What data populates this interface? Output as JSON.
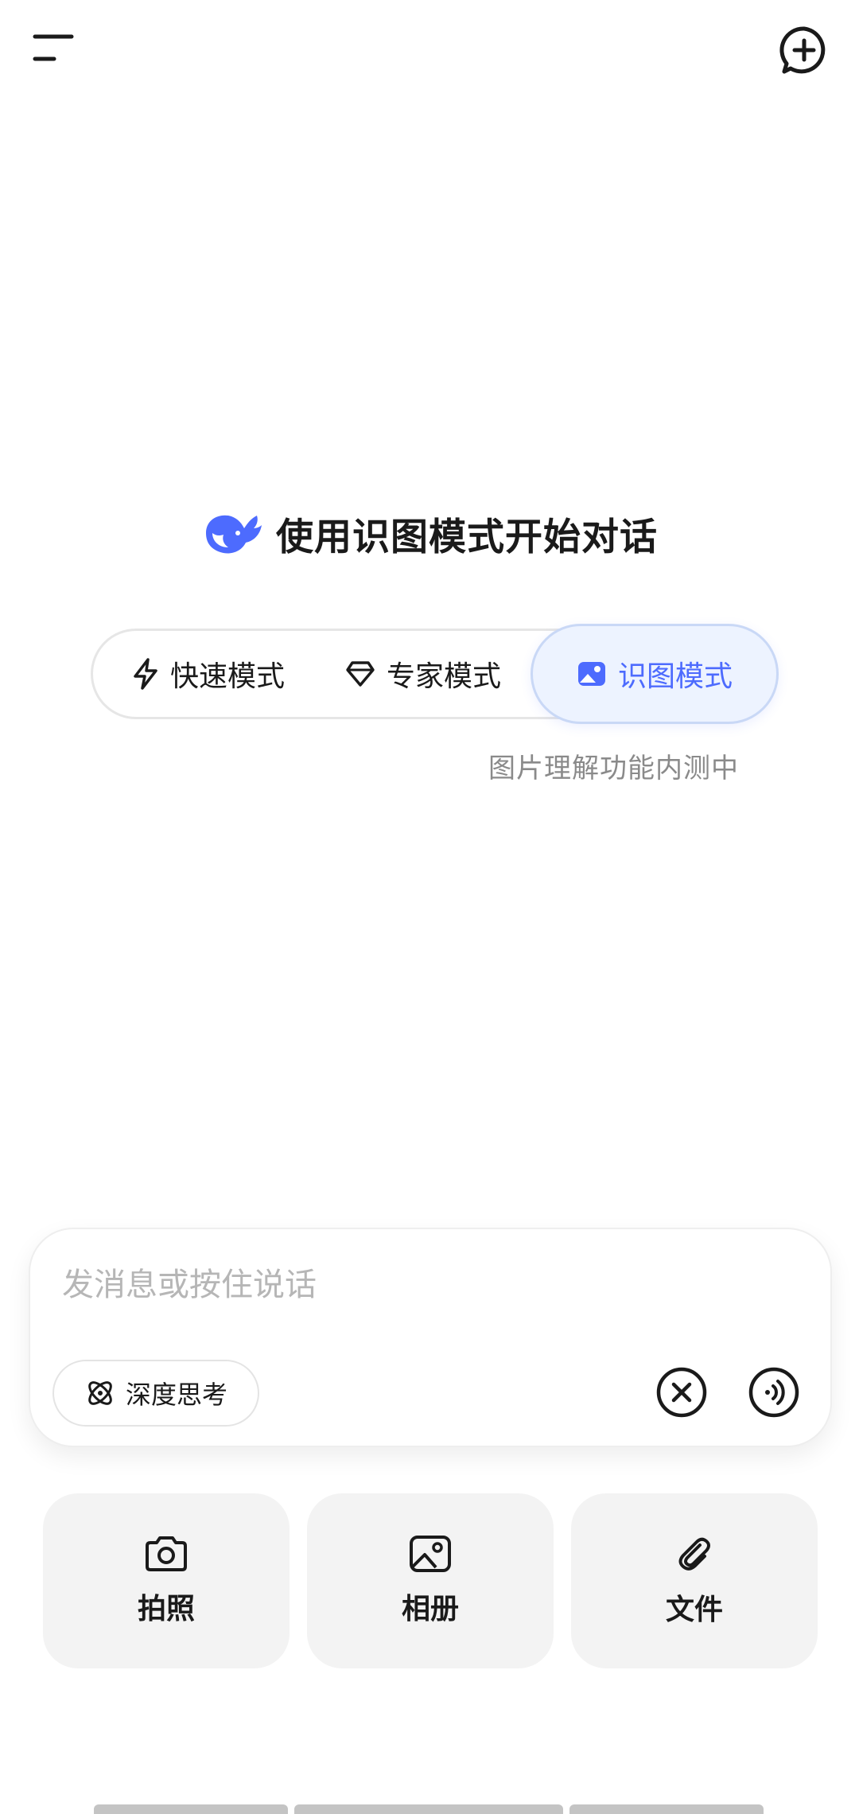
{
  "header": {
    "menu_icon": "menu-icon",
    "new_chat_icon": "new-chat-icon"
  },
  "welcome": {
    "title": "使用识图模式开始对话",
    "logo_icon": "whale-logo-icon"
  },
  "modes": {
    "items": [
      {
        "label": "快速模式",
        "icon": "lightning-icon",
        "selected": false
      },
      {
        "label": "专家模式",
        "icon": "diamond-icon",
        "selected": false
      },
      {
        "label": "识图模式",
        "icon": "image-icon",
        "selected": true
      }
    ],
    "note": "图片理解功能内测中"
  },
  "composer": {
    "placeholder": "发消息或按住说话",
    "value": "",
    "deepthink_label": "深度思考",
    "deepthink_icon": "atom-icon",
    "clear_icon": "close-circle-icon",
    "voice_icon": "voice-wave-icon"
  },
  "actions": [
    {
      "label": "拍照",
      "icon": "camera-icon"
    },
    {
      "label": "相册",
      "icon": "photo-album-icon"
    },
    {
      "label": "文件",
      "icon": "paperclip-icon"
    }
  ],
  "colors": {
    "accent": "#4d6bfe",
    "accent_bg": "#edf3ff",
    "muted_text": "#8a8a8a",
    "placeholder": "#b6b6b6",
    "card_bg": "#f3f3f3"
  }
}
